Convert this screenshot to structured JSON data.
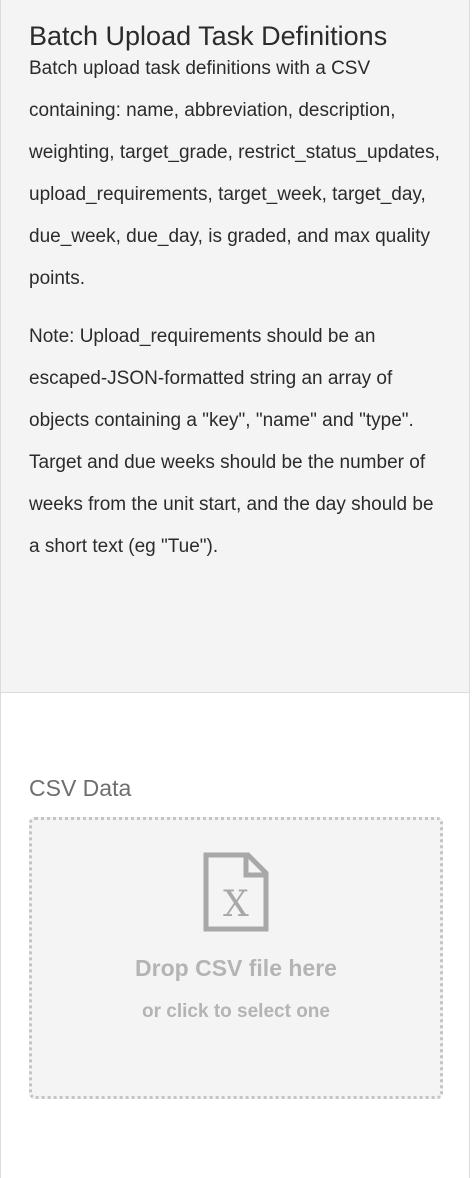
{
  "panel": {
    "title": "Batch Upload Task Definitions",
    "description": "Batch upload task definitions with a CSV containing: name, abbreviation, description, weighting, target_grade, restrict_status_updates, upload_requirements, target_week, target_day, due_week, due_day, is graded, and max quality points.",
    "note": "Note: Upload_requirements should be an escaped-JSON-formatted string an array of objects containing a \"key\", \"name\" and \"type\". Target and due weeks should be the number of weeks from the unit start, and the day should be a short text (eg \"Tue\")."
  },
  "form": {
    "csv_label": "CSV Data",
    "dropzone": {
      "icon": "csv-file-icon",
      "primary_text": "Drop CSV file here",
      "secondary_text": "or click to select one"
    }
  },
  "colors": {
    "heading_bg": "#f4f4f4",
    "dropzone_bg": "#f4f4f4",
    "dropzone_text": "#b4b4b4",
    "label_text": "#6e6e6e",
    "border": "#dcdcdc"
  }
}
